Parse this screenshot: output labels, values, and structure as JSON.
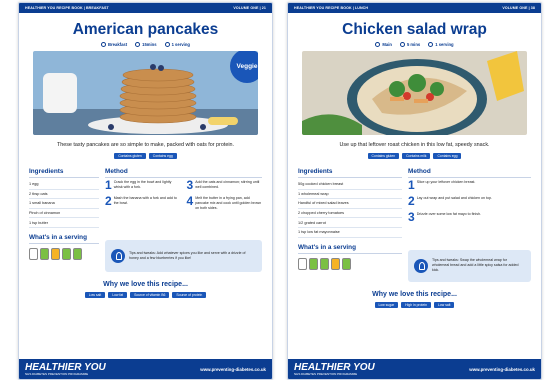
{
  "left": {
    "topbar_left": "HEALTHIER YOU RECIPE BOOK | BREAKFAST",
    "topbar_right": "VOLUME ONE | 21",
    "title": "American pancakes",
    "meta": [
      "Breakfast",
      "15mins",
      "1 serving"
    ],
    "badge": "Veggie",
    "intro": "These tasty pancakes are so simple to make, packed with oats for protein.",
    "tags": [
      "Contains gluten",
      "Contains egg"
    ],
    "ingredients_heading": "Ingredients",
    "ingredients": [
      "1 egg",
      "2 tbsp oats",
      "1 small banana",
      "Pinch of cinnamon",
      "1 tsp butter"
    ],
    "method_heading": "Method",
    "steps": [
      {
        "n": "1",
        "text": "Crack the egg in the bowl and lightly whisk with a fork."
      },
      {
        "n": "3",
        "text": "Add the oats and cinnamon; stirring until well combined."
      },
      {
        "n": "2",
        "text": "Mash the banana with a fork and add to the bowl."
      },
      {
        "n": "4",
        "text": "Melt the butter in a frying pan, add pancake mix and cook until golden brown on both sides."
      }
    ],
    "serving_heading": "What's in a serving",
    "tip": "Tips and tweaks: Add whatever spices you like and serve with a drizzle of honey and a few blueberries if you like!",
    "why_heading": "Why we love this recipe...",
    "why_tags": [
      "Low salt",
      "Low fat",
      "Source of vitamin B6",
      "Source of protein"
    ],
    "brand": "HEALTHIER YOU",
    "brand_sub": "NHS DIABETES PREVENTION PROGRAMME",
    "url": "www.preventing-diabetes.co.uk"
  },
  "right": {
    "topbar_left": "HEALTHIER YOU RECIPE BOOK | LUNCH",
    "topbar_right": "VOLUME ONE | 38",
    "title": "Chicken salad wrap",
    "meta": [
      "Main",
      "5 mins",
      "1 serving"
    ],
    "intro": "Use up that leftover roast chicken in this low fat, speedy snack.",
    "tags": [
      "Contains gluten",
      "Contains milk",
      "Contains egg"
    ],
    "ingredients_heading": "Ingredients",
    "ingredients": [
      "50g cooked chicken breast",
      "1 wholemeal wrap",
      "Handful of mixed salad leaves",
      "2 chopped cherry tomatoes",
      "1/2 grated carrot",
      "1 tsp low fat mayonnaise"
    ],
    "method_heading": "Method",
    "steps": [
      {
        "n": "1",
        "text": "Slice up your leftover chicken breast."
      },
      {
        "n": "2",
        "text": "Lay out wrap and put salad and chicken on top."
      },
      {
        "n": "3",
        "text": "Drizzle over some low fat mayo to finish."
      }
    ],
    "serving_heading": "What's in a serving",
    "tip": "Tips and tweaks: Swap the wholemeal wrap for wholemeal bread and add a little spicy salsa for added kick.",
    "why_heading": "Why we love this recipe...",
    "why_tags": [
      "Low sugar",
      "High in protein",
      "Low salt"
    ],
    "brand": "HEALTHIER YOU",
    "brand_sub": "NHS DIABETES PREVENTION PROGRAMME",
    "url": "www.preventing-diabetes.co.uk"
  },
  "colors": {
    "brand_blue": "#0b3d91",
    "accent_blue": "#1a56b8",
    "tip_bg": "#dde8f6"
  }
}
